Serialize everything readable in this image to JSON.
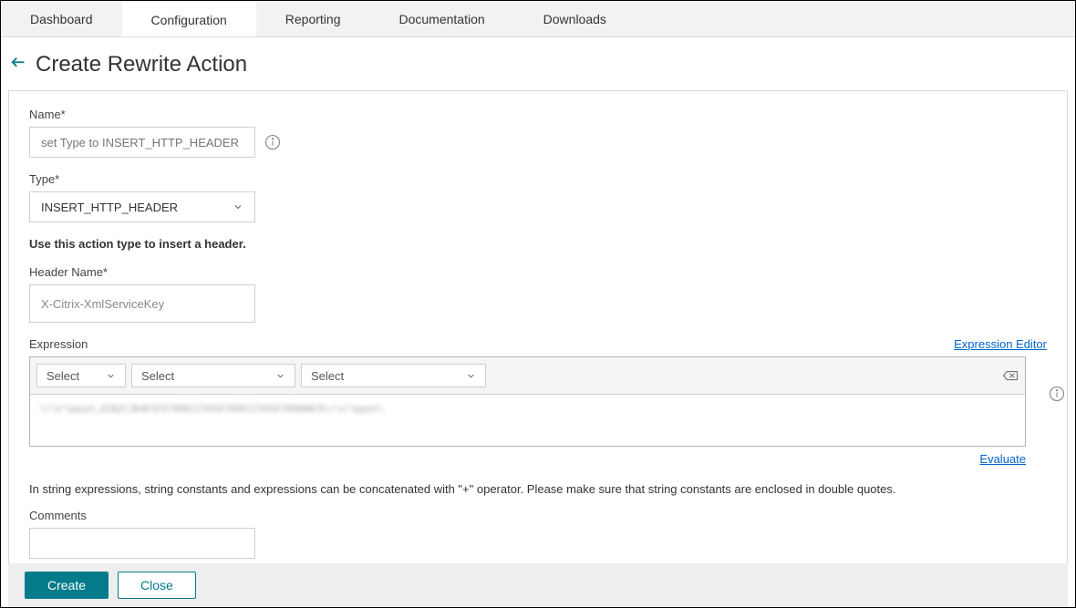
{
  "tabs": {
    "dashboard": "Dashboard",
    "configuration": "Configuration",
    "reporting": "Reporting",
    "documentation": "Documentation",
    "downloads": "Downloads"
  },
  "header": {
    "title": "Create Rewrite Action"
  },
  "form": {
    "name_label": "Name*",
    "name_placeholder": "set Type to INSERT_HTTP_HEADER",
    "type_label": "Type*",
    "type_value": "INSERT_HTTP_HEADER",
    "type_help": "Use this action type to insert a header.",
    "header_name_label": "Header Name*",
    "header_name_value": "X-Citrix-XmlServiceKey",
    "expression_label": "Expression",
    "expression_editor_link": "Expression Editor",
    "expression_select1": "Select",
    "expression_select2": "Select",
    "expression_select3": "Select",
    "expression_body": "\\r\\n\"&quot;A1B2C3D4E5F6789012345678901234567890ABCD\\r\\n\"&quot;",
    "evaluate_link": "Evaluate",
    "hint": "In string expressions, string constants and expressions can be concatenated with \"+\" operator. Please make sure that string constants are enclosed in double quotes.",
    "comments_label": "Comments"
  },
  "footer": {
    "create": "Create",
    "close": "Close"
  }
}
